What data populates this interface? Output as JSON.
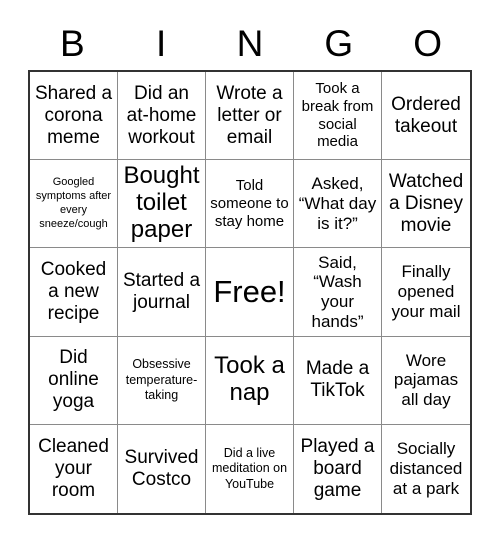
{
  "card": {
    "title_letters": [
      "B",
      "I",
      "N",
      "G",
      "O"
    ],
    "columns": 5,
    "rows": 5,
    "background_color": "#ffffff",
    "text_color": "#000000",
    "outer_border_color": "#333333",
    "inner_border_color": "#8a8a8a",
    "free_space_index": 12,
    "cells": [
      {
        "text": "Shared a corona meme",
        "size": "lg"
      },
      {
        "text": "Did an at-home workout",
        "size": "lg"
      },
      {
        "text": "Wrote a letter or email",
        "size": "lg"
      },
      {
        "text": "Took a break from social media",
        "size": "sm"
      },
      {
        "text": "Ordered takeout",
        "size": "lg"
      },
      {
        "text": "Googled symptoms after every sneeze/cough",
        "size": "xxs"
      },
      {
        "text": "Bought toilet paper",
        "size": "xl"
      },
      {
        "text": "Told someone to stay home",
        "size": "sm"
      },
      {
        "text": "Asked, “What day is it?”",
        "size": "md"
      },
      {
        "text": "Watched a Disney movie",
        "size": "lg"
      },
      {
        "text": "Cooked a new recipe",
        "size": "lg"
      },
      {
        "text": "Started a journal",
        "size": "lg"
      },
      {
        "text": "Free!",
        "size": "xxl"
      },
      {
        "text": "Said, “Wash your hands”",
        "size": "md"
      },
      {
        "text": "Finally opened your mail",
        "size": "md"
      },
      {
        "text": "Did online yoga",
        "size": "lg"
      },
      {
        "text": "Obsessive temperature-taking",
        "size": "xs"
      },
      {
        "text": "Took a nap",
        "size": "xl"
      },
      {
        "text": "Made a TikTok",
        "size": "lg"
      },
      {
        "text": "Wore pajamas all day",
        "size": "md"
      },
      {
        "text": "Cleaned your room",
        "size": "lg"
      },
      {
        "text": "Survived Costco",
        "size": "lg"
      },
      {
        "text": "Did a live meditation on YouTube",
        "size": "xs"
      },
      {
        "text": "Played a board game",
        "size": "lg"
      },
      {
        "text": "Socially distanced at a park",
        "size": "md"
      }
    ]
  }
}
